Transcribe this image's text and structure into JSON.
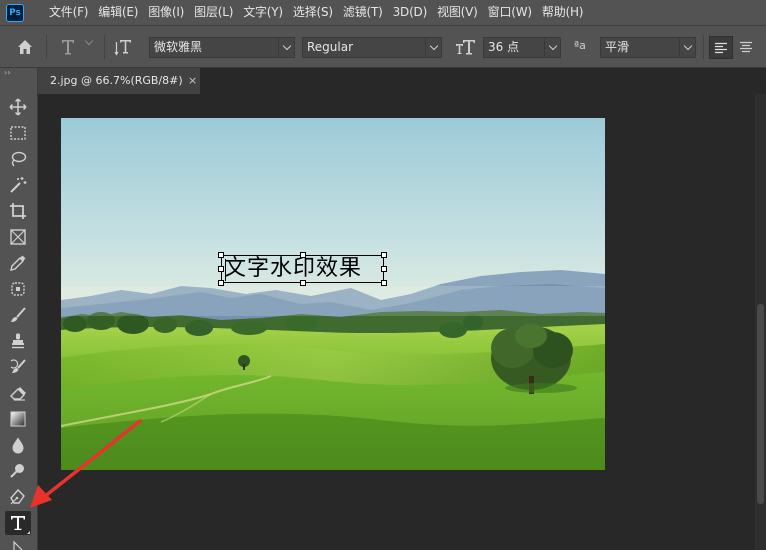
{
  "app": {
    "logo_text": "Ps",
    "menu": [
      "文件(F)",
      "编辑(E)",
      "图像(I)",
      "图层(L)",
      "文字(Y)",
      "选择(S)",
      "滤镜(T)",
      "3D(D)",
      "视图(V)",
      "窗口(W)",
      "帮助(H)"
    ]
  },
  "options_bar": {
    "font_family": "微软雅黑",
    "font_style": "Regular",
    "font_size": "36 点",
    "aa_label": "ªa",
    "anti_alias": "平滑"
  },
  "document_tab": {
    "title": "2.jpg @ 66.7%(RGB/8#)",
    "close": "×"
  },
  "canvas": {
    "text_layer": "文字水印效果"
  },
  "toolbar": {
    "collapse": "››",
    "tools": [
      "move",
      "marquee",
      "lasso",
      "magic-wand",
      "crop",
      "frame",
      "eyedropper",
      "healing",
      "brush",
      "stamp",
      "history-brush",
      "eraser",
      "gradient",
      "blur",
      "dodge",
      "pen",
      "type",
      "path-select"
    ],
    "active_tool": "type"
  },
  "annotation": {
    "arrow_color": "#e8332d"
  }
}
